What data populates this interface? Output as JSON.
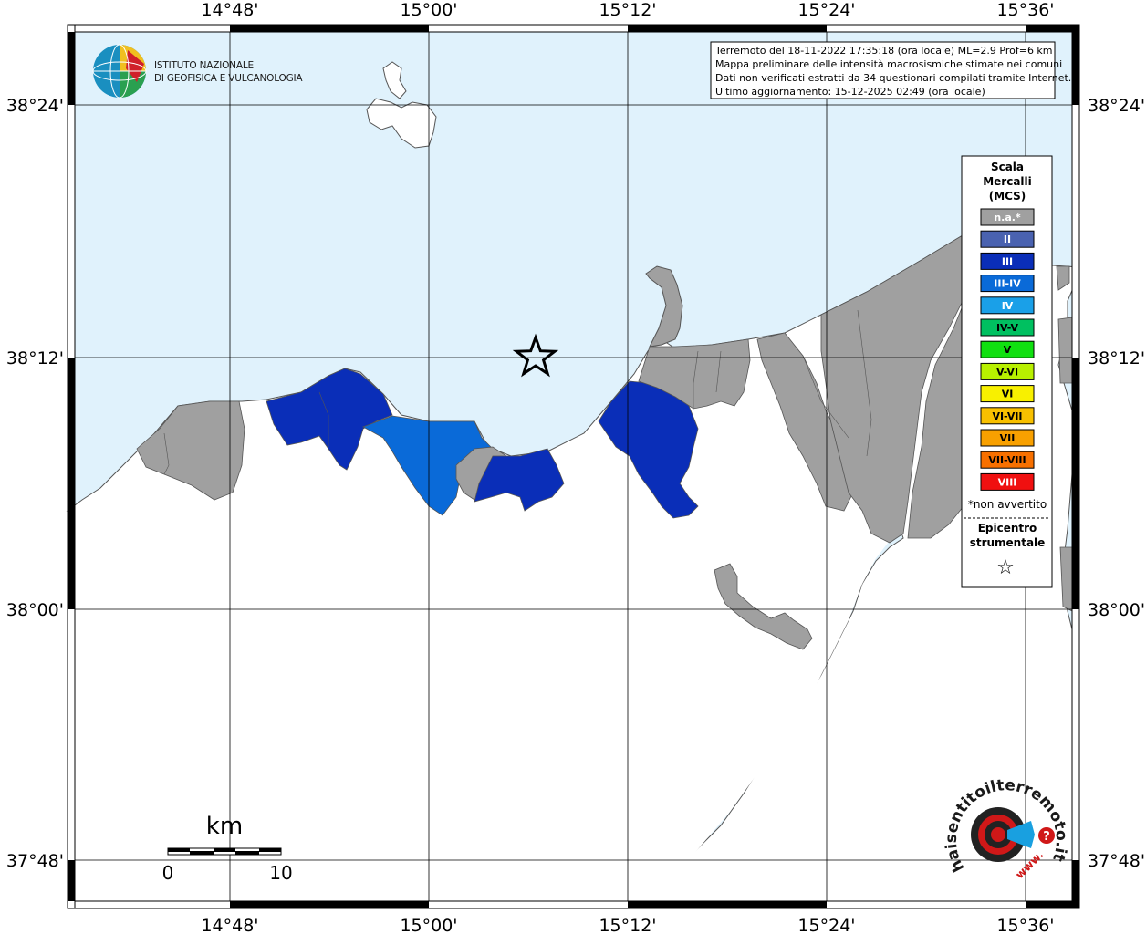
{
  "info_box": {
    "line1": "Terremoto del 18-11-2022 17:35:18 (ora locale) ML=2.9 Prof=6 km",
    "line2": "Mappa preliminare delle intensità macrosismiche stimate nei comuni",
    "line3": "Dati non verificati estratti da 34 questionari compilati tramite Internet.",
    "line4": "Ultimo aggiornamento: 15-12-2025 02:49 (ora locale)"
  },
  "logo": {
    "line1": "ISTITUTO NAZIONALE",
    "line2": "DI GEOFISICA E VULCANOLOGIA"
  },
  "axes": {
    "lon_labels": [
      "14°48'",
      "15°00'",
      "15°12'",
      "15°24'",
      "15°36'"
    ],
    "lat_labels": [
      "38°24'",
      "38°12'",
      "38°00'",
      "37°48'"
    ]
  },
  "legend": {
    "title1": "Scala",
    "title2": "Mercalli",
    "title3": "(MCS)",
    "items": [
      {
        "label": "n.a.*",
        "color": "#a0a0a0",
        "text_color": "#ffffff"
      },
      {
        "label": "II",
        "color": "#4a62b0",
        "text_color": "#ffffff"
      },
      {
        "label": "III",
        "color": "#0a2eb8",
        "text_color": "#ffffff"
      },
      {
        "label": "III-IV",
        "color": "#0a6ad8",
        "text_color": "#ffffff"
      },
      {
        "label": "IV",
        "color": "#1aa0e8",
        "text_color": "#ffffff"
      },
      {
        "label": "IV-V",
        "color": "#00c060",
        "text_color": "#000000"
      },
      {
        "label": "V",
        "color": "#10e010",
        "text_color": "#000000"
      },
      {
        "label": "V-VI",
        "color": "#b8f000",
        "text_color": "#000000"
      },
      {
        "label": "VI",
        "color": "#f8f000",
        "text_color": "#000000"
      },
      {
        "label": "VI-VII",
        "color": "#f8c000",
        "text_color": "#000000"
      },
      {
        "label": "VII",
        "color": "#f8a000",
        "text_color": "#000000"
      },
      {
        "label": "VII-VIII",
        "color": "#f87000",
        "text_color": "#000000"
      },
      {
        "label": "VIII",
        "color": "#f01010",
        "text_color": "#ffffff"
      }
    ],
    "note": "*non avvertito",
    "epicenter1": "Epicentro",
    "epicenter2": "strumentale",
    "epicenter_symbol": "☆"
  },
  "scale_bar": {
    "unit": "km",
    "label_start": "0",
    "label_end": "10"
  },
  "haisentito": {
    "text": "haisentitoilterremoto.it",
    "www": "www.",
    "q": "?"
  },
  "colors": {
    "sea": "#e0f2fc",
    "land": "#ffffff",
    "na": "#a0a0a0",
    "III": "#0a2eb8",
    "III_IV": "#0a6ad8"
  }
}
